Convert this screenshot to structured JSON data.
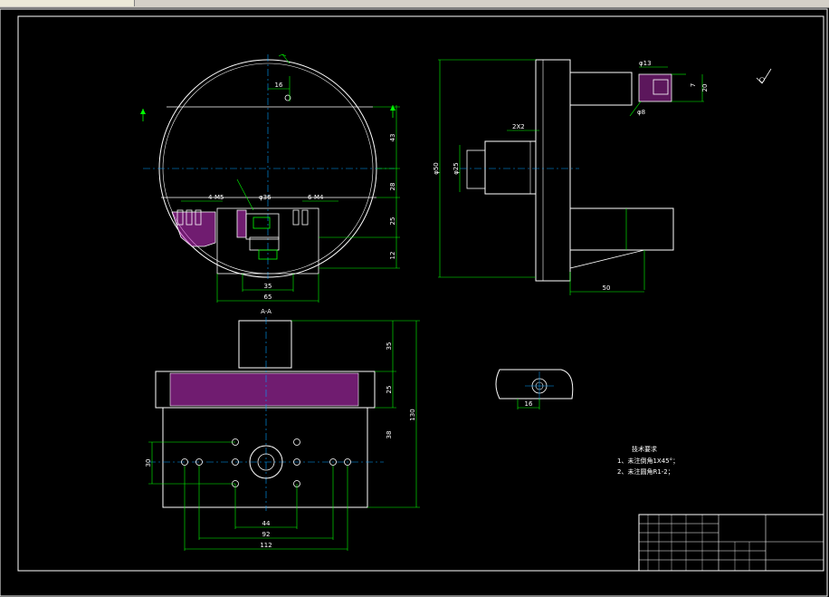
{
  "colors": {
    "background": "#000000",
    "outline": "#ffffff",
    "dimension": "#00ff00",
    "hatch": "#cc33cc",
    "centerline": "#00a0ff"
  },
  "views": {
    "top_view": {
      "dims": {
        "d16": "16",
        "d43": "43",
        "d28": "28",
        "d25": "25",
        "d12": "12",
        "d35": "35",
        "d65": "65",
        "d36": "φ36",
        "hole_left": "4-M5",
        "hole_right": "6-M4",
        "section": "A"
      }
    },
    "side_view": {
      "dims": {
        "d50": "φ50",
        "d25": "φ25",
        "d2x2": "2X2",
        "d50b": "50",
        "d13": "φ13",
        "d20": "20",
        "d8": "φ8",
        "d7": "7"
      }
    },
    "section_view": {
      "title": "A-A",
      "dims": {
        "d35": "35",
        "d25": "25",
        "d38": "38",
        "d130": "130",
        "d30": "30",
        "d44": "44",
        "d92": "92",
        "d112": "112"
      }
    },
    "detail_view": {
      "dims": {
        "d16": "16"
      }
    }
  },
  "tech_notes": {
    "title": "技术要求",
    "items": [
      "1、未注倒角1X45°；",
      "2、未注圆角R1-2；"
    ]
  }
}
